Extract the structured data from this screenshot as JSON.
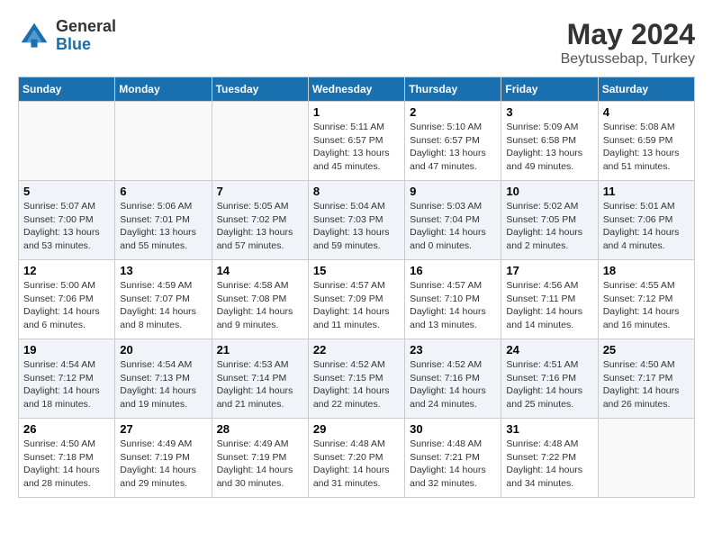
{
  "logo": {
    "general": "General",
    "blue": "Blue"
  },
  "title": {
    "month_year": "May 2024",
    "location": "Beytussebap, Turkey"
  },
  "weekdays": [
    "Sunday",
    "Monday",
    "Tuesday",
    "Wednesday",
    "Thursday",
    "Friday",
    "Saturday"
  ],
  "weeks": [
    [
      {
        "day": "",
        "detail": ""
      },
      {
        "day": "",
        "detail": ""
      },
      {
        "day": "",
        "detail": ""
      },
      {
        "day": "1",
        "detail": "Sunrise: 5:11 AM\nSunset: 6:57 PM\nDaylight: 13 hours\nand 45 minutes."
      },
      {
        "day": "2",
        "detail": "Sunrise: 5:10 AM\nSunset: 6:57 PM\nDaylight: 13 hours\nand 47 minutes."
      },
      {
        "day": "3",
        "detail": "Sunrise: 5:09 AM\nSunset: 6:58 PM\nDaylight: 13 hours\nand 49 minutes."
      },
      {
        "day": "4",
        "detail": "Sunrise: 5:08 AM\nSunset: 6:59 PM\nDaylight: 13 hours\nand 51 minutes."
      }
    ],
    [
      {
        "day": "5",
        "detail": "Sunrise: 5:07 AM\nSunset: 7:00 PM\nDaylight: 13 hours\nand 53 minutes."
      },
      {
        "day": "6",
        "detail": "Sunrise: 5:06 AM\nSunset: 7:01 PM\nDaylight: 13 hours\nand 55 minutes."
      },
      {
        "day": "7",
        "detail": "Sunrise: 5:05 AM\nSunset: 7:02 PM\nDaylight: 13 hours\nand 57 minutes."
      },
      {
        "day": "8",
        "detail": "Sunrise: 5:04 AM\nSunset: 7:03 PM\nDaylight: 13 hours\nand 59 minutes."
      },
      {
        "day": "9",
        "detail": "Sunrise: 5:03 AM\nSunset: 7:04 PM\nDaylight: 14 hours\nand 0 minutes."
      },
      {
        "day": "10",
        "detail": "Sunrise: 5:02 AM\nSunset: 7:05 PM\nDaylight: 14 hours\nand 2 minutes."
      },
      {
        "day": "11",
        "detail": "Sunrise: 5:01 AM\nSunset: 7:06 PM\nDaylight: 14 hours\nand 4 minutes."
      }
    ],
    [
      {
        "day": "12",
        "detail": "Sunrise: 5:00 AM\nSunset: 7:06 PM\nDaylight: 14 hours\nand 6 minutes."
      },
      {
        "day": "13",
        "detail": "Sunrise: 4:59 AM\nSunset: 7:07 PM\nDaylight: 14 hours\nand 8 minutes."
      },
      {
        "day": "14",
        "detail": "Sunrise: 4:58 AM\nSunset: 7:08 PM\nDaylight: 14 hours\nand 9 minutes."
      },
      {
        "day": "15",
        "detail": "Sunrise: 4:57 AM\nSunset: 7:09 PM\nDaylight: 14 hours\nand 11 minutes."
      },
      {
        "day": "16",
        "detail": "Sunrise: 4:57 AM\nSunset: 7:10 PM\nDaylight: 14 hours\nand 13 minutes."
      },
      {
        "day": "17",
        "detail": "Sunrise: 4:56 AM\nSunset: 7:11 PM\nDaylight: 14 hours\nand 14 minutes."
      },
      {
        "day": "18",
        "detail": "Sunrise: 4:55 AM\nSunset: 7:12 PM\nDaylight: 14 hours\nand 16 minutes."
      }
    ],
    [
      {
        "day": "19",
        "detail": "Sunrise: 4:54 AM\nSunset: 7:12 PM\nDaylight: 14 hours\nand 18 minutes."
      },
      {
        "day": "20",
        "detail": "Sunrise: 4:54 AM\nSunset: 7:13 PM\nDaylight: 14 hours\nand 19 minutes."
      },
      {
        "day": "21",
        "detail": "Sunrise: 4:53 AM\nSunset: 7:14 PM\nDaylight: 14 hours\nand 21 minutes."
      },
      {
        "day": "22",
        "detail": "Sunrise: 4:52 AM\nSunset: 7:15 PM\nDaylight: 14 hours\nand 22 minutes."
      },
      {
        "day": "23",
        "detail": "Sunrise: 4:52 AM\nSunset: 7:16 PM\nDaylight: 14 hours\nand 24 minutes."
      },
      {
        "day": "24",
        "detail": "Sunrise: 4:51 AM\nSunset: 7:16 PM\nDaylight: 14 hours\nand 25 minutes."
      },
      {
        "day": "25",
        "detail": "Sunrise: 4:50 AM\nSunset: 7:17 PM\nDaylight: 14 hours\nand 26 minutes."
      }
    ],
    [
      {
        "day": "26",
        "detail": "Sunrise: 4:50 AM\nSunset: 7:18 PM\nDaylight: 14 hours\nand 28 minutes."
      },
      {
        "day": "27",
        "detail": "Sunrise: 4:49 AM\nSunset: 7:19 PM\nDaylight: 14 hours\nand 29 minutes."
      },
      {
        "day": "28",
        "detail": "Sunrise: 4:49 AM\nSunset: 7:19 PM\nDaylight: 14 hours\nand 30 minutes."
      },
      {
        "day": "29",
        "detail": "Sunrise: 4:48 AM\nSunset: 7:20 PM\nDaylight: 14 hours\nand 31 minutes."
      },
      {
        "day": "30",
        "detail": "Sunrise: 4:48 AM\nSunset: 7:21 PM\nDaylight: 14 hours\nand 32 minutes."
      },
      {
        "day": "31",
        "detail": "Sunrise: 4:48 AM\nSunset: 7:22 PM\nDaylight: 14 hours\nand 34 minutes."
      },
      {
        "day": "",
        "detail": ""
      }
    ]
  ]
}
